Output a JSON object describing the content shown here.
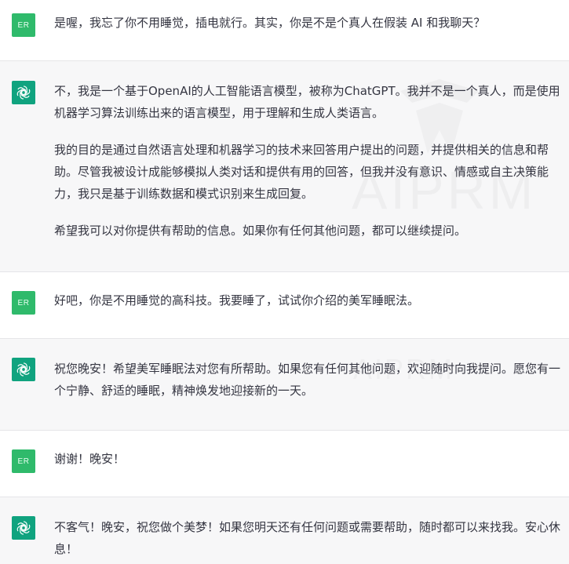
{
  "conversation": {
    "user_avatar_label": "ER",
    "messages": [
      {
        "role": "user",
        "paragraphs": [
          "是喔，我忘了你不用睡觉，插电就行。其实，你是不是个真人在假装 AI 和我聊天？"
        ]
      },
      {
        "role": "assistant",
        "paragraphs": [
          "不，我是一个基于OpenAI的人工智能语言模型，被称为ChatGPT。我并不是一个真人，而是使用机器学习算法训练出来的语言模型，用于理解和生成人类语言。",
          "我的目的是通过自然语言处理和机器学习的技术来回答用户提出的问题，并提供相关的信息和帮助。尽管我被设计成能够模拟人类对话和提供有用的回答，但我并没有意识、情感或自主决策能力，我只是基于训练数据和模式识别来生成回复。",
          "希望我可以对你提供有帮助的信息。如果你有任何其他问题，都可以继续提问。"
        ]
      },
      {
        "role": "user",
        "paragraphs": [
          "好吧，你是不用睡觉的高科技。我要睡了，试试你介绍的美军睡眠法。"
        ]
      },
      {
        "role": "assistant",
        "paragraphs": [
          "祝您晚安！希望美军睡眠法对您有所帮助。如果您有任何其他问题，欢迎随时向我提问。愿您有一个宁静、舒适的睡眠，精神焕发地迎接新的一天。"
        ]
      },
      {
        "role": "user",
        "paragraphs": [
          "谢谢！晚安！"
        ]
      },
      {
        "role": "assistant",
        "paragraphs": [
          "不客气！晚安，祝您做个美梦！如果您明天还有任何问题或需要帮助，随时都可以来找我。安心休息！"
        ]
      }
    ]
  },
  "watermark": {
    "text": "AIPRM",
    "faint_text": "AIPRM"
  },
  "icons": {
    "assistant_avatar": "openai-logo-icon",
    "watermark_logo": "aiprm-logo-icon"
  },
  "colors": {
    "user_avatar_bg": "#2fba6b",
    "assistant_avatar_bg": "#10a37f",
    "assistant_row_bg": "#f7f7f8",
    "user_row_bg": "#ffffff",
    "text": "#343541"
  }
}
